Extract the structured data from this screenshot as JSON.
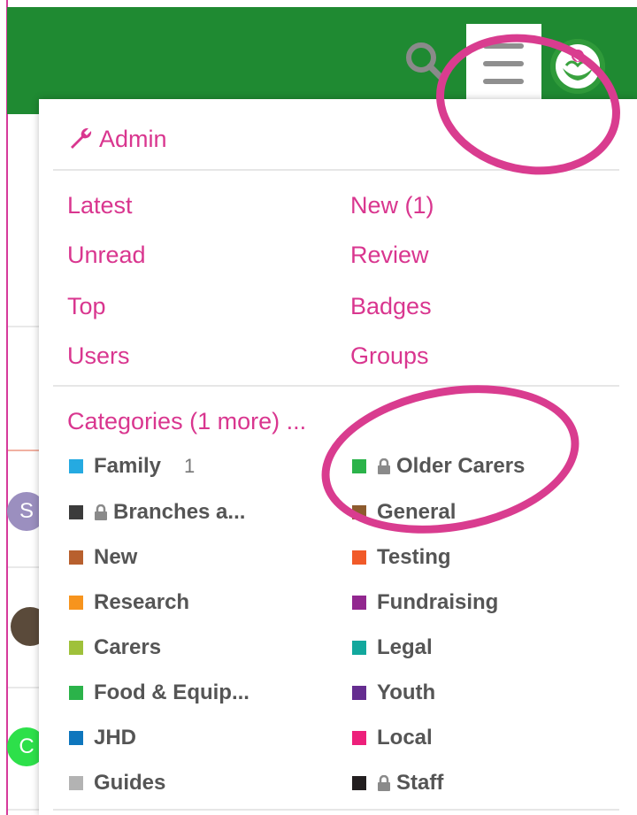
{
  "header": {
    "search_icon": "search-icon",
    "menu_icon": "hamburger-menu-icon",
    "avatar_icon": "user-avatar-icon",
    "header_color": "#1f8a32"
  },
  "background": {
    "avatar_letters": [
      "S",
      "",
      "C"
    ]
  },
  "menu": {
    "admin_label": "Admin",
    "admin_icon": "wrench-icon",
    "links": [
      {
        "label": "Latest"
      },
      {
        "label": "New (1)"
      },
      {
        "label": "Unread"
      },
      {
        "label": "Review"
      },
      {
        "label": "Top"
      },
      {
        "label": "Badges"
      },
      {
        "label": "Users"
      },
      {
        "label": "Groups"
      }
    ],
    "categories_title": "Categories (1 more) ...",
    "categories": [
      {
        "name": "Family",
        "color": "#25aae1",
        "locked": false,
        "count": "1"
      },
      {
        "name": "Older Carers",
        "color": "#2bb34a",
        "locked": true,
        "count": ""
      },
      {
        "name": "Branches a...",
        "color": "#3b3b3b",
        "locked": true,
        "count": ""
      },
      {
        "name": "General",
        "color": "#8d5b2e",
        "locked": false,
        "count": ""
      },
      {
        "name": "New",
        "color": "#b8602e",
        "locked": false,
        "count": ""
      },
      {
        "name": "Testing",
        "color": "#f15a29",
        "locked": false,
        "count": ""
      },
      {
        "name": "Research",
        "color": "#f7941d",
        "locked": false,
        "count": ""
      },
      {
        "name": "Fundraising",
        "color": "#92278f",
        "locked": false,
        "count": ""
      },
      {
        "name": "Carers",
        "color": "#9fc13a",
        "locked": false,
        "count": ""
      },
      {
        "name": "Legal",
        "color": "#12a89d",
        "locked": false,
        "count": ""
      },
      {
        "name": "Food & Equip...",
        "color": "#2bb34a",
        "locked": false,
        "count": ""
      },
      {
        "name": "Youth",
        "color": "#652d90",
        "locked": false,
        "count": ""
      },
      {
        "name": "JHD",
        "color": "#0e76bd",
        "locked": false,
        "count": ""
      },
      {
        "name": "Local",
        "color": "#ed207b",
        "locked": false,
        "count": ""
      },
      {
        "name": "Guides",
        "color": "#b3b3b3",
        "locked": false,
        "count": ""
      },
      {
        "name": "Staff",
        "color": "#231f20",
        "locked": true,
        "count": ""
      }
    ]
  },
  "annotations": {
    "highlight_color": "#d93c8f"
  }
}
